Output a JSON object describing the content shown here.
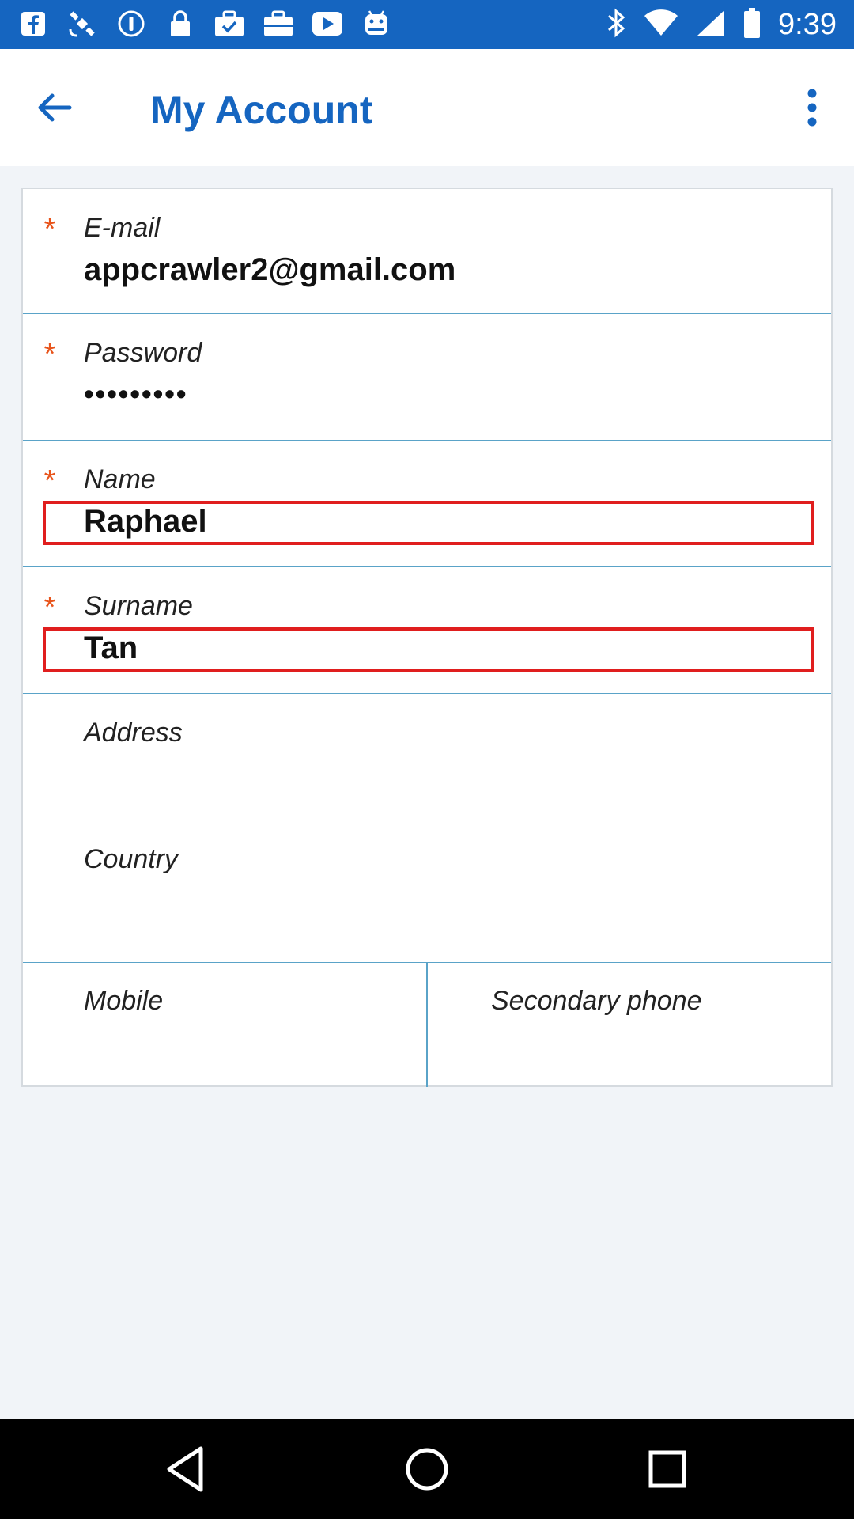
{
  "status_bar": {
    "time": "9:39",
    "left_icons": [
      "facebook-icon",
      "satellite-icon",
      "info-icon",
      "lock-icon",
      "briefcase-check-icon",
      "briefcase-icon",
      "play-icon",
      "android-icon"
    ],
    "right_icons": [
      "bluetooth-icon",
      "wifi-icon",
      "signal-icon",
      "battery-icon"
    ],
    "background": "#1565c0"
  },
  "app_bar": {
    "title": "My Account",
    "accent_color": "#1565c0"
  },
  "form": {
    "required_marker": "*",
    "required_color": "#e8541b",
    "email": {
      "label": "E-mail",
      "value": "appcrawler2@gmail.com"
    },
    "password": {
      "label": "Password",
      "value": "•••••••••"
    },
    "name": {
      "label": "Name",
      "value": "Raphael"
    },
    "surname": {
      "label": "Surname",
      "value": "Tan"
    },
    "address": {
      "label": "Address",
      "value": ""
    },
    "country": {
      "label": "Country",
      "value": ""
    },
    "mobile": {
      "label": "Mobile",
      "value": ""
    },
    "secondary_phone": {
      "label": "Secondary phone",
      "value": ""
    }
  },
  "highlight_color": "#e01e1e"
}
